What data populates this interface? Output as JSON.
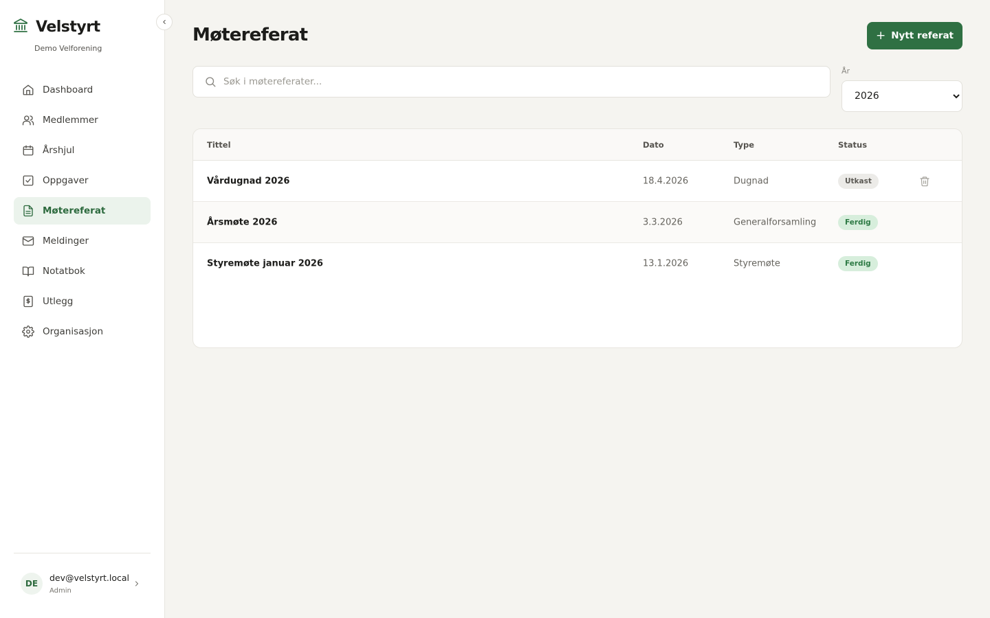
{
  "brand": {
    "name": "Velstyrt",
    "org": "Demo Velforening"
  },
  "nav": [
    {
      "label": "Dashboard",
      "icon": "home-icon"
    },
    {
      "label": "Medlemmer",
      "icon": "users-icon"
    },
    {
      "label": "Årshjul",
      "icon": "calendar-icon"
    },
    {
      "label": "Oppgaver",
      "icon": "checkbox-icon"
    },
    {
      "label": "Møtereferat",
      "icon": "document-icon",
      "active": true
    },
    {
      "label": "Meldinger",
      "icon": "mail-icon"
    },
    {
      "label": "Notatbok",
      "icon": "book-icon"
    },
    {
      "label": "Utlegg",
      "icon": "receipt-icon"
    },
    {
      "label": "Organisasjon",
      "icon": "gear-icon"
    }
  ],
  "user": {
    "initials": "DE",
    "email": "dev@velstyrt.local",
    "role": "Admin"
  },
  "page": {
    "title": "Møtereferat",
    "new_button": "Nytt referat"
  },
  "search": {
    "placeholder": "Søk i møtereferater..."
  },
  "year_filter": {
    "label": "År",
    "selected": "2026"
  },
  "table": {
    "headers": {
      "title": "Tittel",
      "date": "Dato",
      "type": "Type",
      "status": "Status"
    },
    "rows": [
      {
        "title": "Vårdugnad 2026",
        "date": "18.4.2026",
        "type": "Dugnad",
        "status": "Utkast",
        "status_kind": "draft"
      },
      {
        "title": "Årsmøte 2026",
        "date": "3.3.2026",
        "type": "Generalforsamling",
        "status": "Ferdig",
        "status_kind": "done"
      },
      {
        "title": "Styremøte januar 2026",
        "date": "13.1.2026",
        "type": "Styremøte",
        "status": "Ferdig",
        "status_kind": "done"
      }
    ]
  },
  "colors": {
    "accent": "#2f7043",
    "active_bg": "#ebf3ec",
    "done_badge": "#d7eedc",
    "draft_badge": "#ecebe8"
  }
}
